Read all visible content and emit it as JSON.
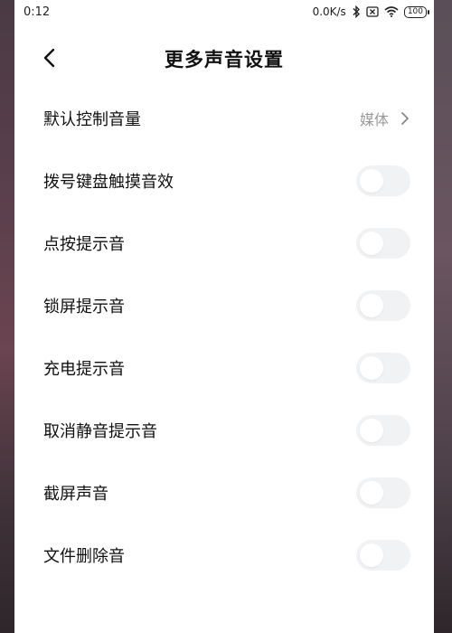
{
  "status_bar": {
    "time": "0:12",
    "network_speed": "0.0K/s",
    "battery": "100",
    "icons": [
      "bluetooth-icon",
      "sim-icon",
      "wifi-icon",
      "battery-icon"
    ]
  },
  "header": {
    "title": "更多声音设置",
    "back_icon": "chevron-left-icon"
  },
  "settings": {
    "default_volume": {
      "label": "默认控制音量",
      "value": "媒体"
    },
    "toggles": [
      {
        "label": "拨号键盘触摸音效",
        "checked": false
      },
      {
        "label": "点按提示音",
        "checked": false
      },
      {
        "label": "锁屏提示音",
        "checked": false
      },
      {
        "label": "充电提示音",
        "checked": false
      },
      {
        "label": "取消静音提示音",
        "checked": false
      },
      {
        "label": "截屏声音",
        "checked": false
      },
      {
        "label": "文件删除音",
        "checked": false
      }
    ]
  },
  "colors": {
    "background": "#ffffff",
    "text": "#111111",
    "secondary_text": "#999999",
    "toggle_off_track": "#f1f2f4"
  }
}
